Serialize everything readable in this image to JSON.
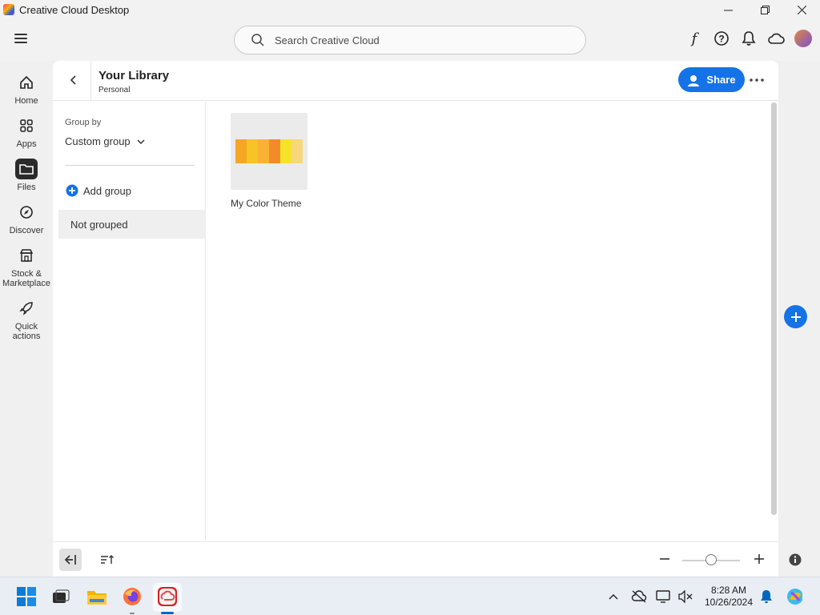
{
  "window": {
    "title": "Creative Cloud Desktop",
    "controls": [
      "minimize-icon",
      "restore-icon",
      "close-icon"
    ]
  },
  "topbar": {
    "search_placeholder": "Search Creative Cloud",
    "icons": [
      "fonts-icon",
      "help-icon",
      "notifications-icon",
      "cloud-icon",
      "avatar"
    ]
  },
  "rail": {
    "items": [
      {
        "label": "Home",
        "icon": "home-icon"
      },
      {
        "label": "Apps",
        "icon": "apps-icon"
      },
      {
        "label": "Files",
        "icon": "folder-icon",
        "active": true
      },
      {
        "label": "Discover",
        "icon": "compass-icon"
      },
      {
        "label": "Stock &\nMarketplace",
        "icon": "store-icon"
      },
      {
        "label": "Quick\nactions",
        "icon": "rocket-icon"
      }
    ]
  },
  "library": {
    "title": "Your Library",
    "subtitle": "Personal",
    "share_label": "Share"
  },
  "groups": {
    "group_by_label": "Group by",
    "selected": "Custom group",
    "add_group_label": "Add group",
    "items": [
      "Not grouped"
    ]
  },
  "assets": [
    {
      "name": "My Color Theme",
      "swatches": [
        "#f5a623",
        "#f7c325",
        "#f9b233",
        "#f28c28",
        "#f7e22a",
        "#f8d67a"
      ]
    }
  ],
  "taskbar": {
    "time": "8:28 AM",
    "date": "10/26/2024"
  },
  "colors": {
    "accent": "#1473e6"
  }
}
